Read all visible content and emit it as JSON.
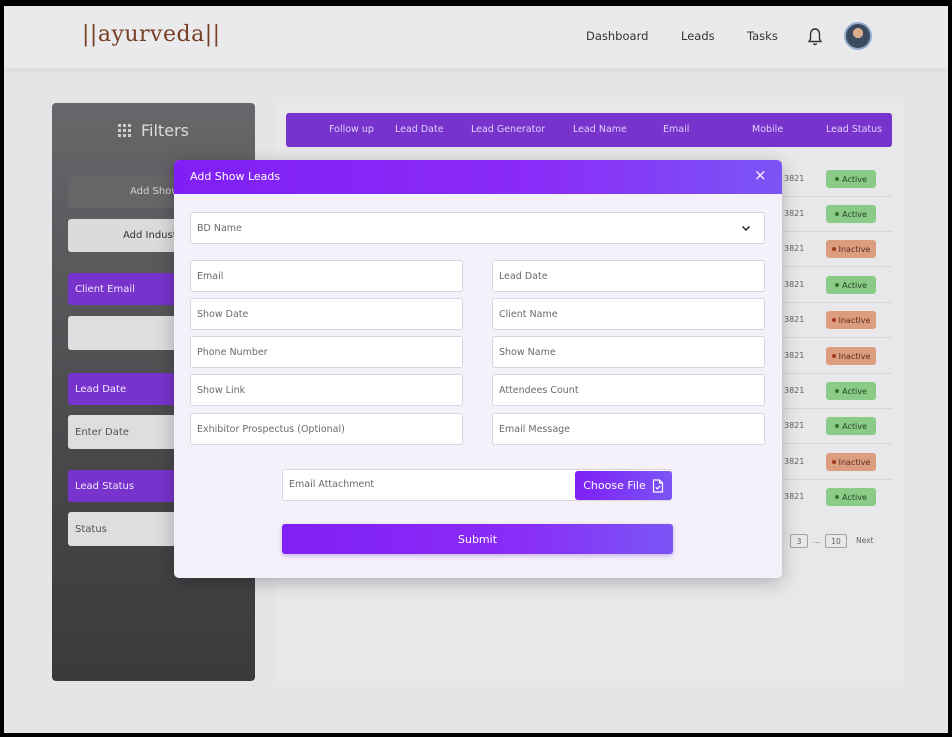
{
  "brand": {
    "logo_text": "||ayurveda||"
  },
  "nav": {
    "items": [
      "Dashboard",
      "Leads",
      "Tasks"
    ]
  },
  "sidebar": {
    "title": "Filters",
    "add_show_button": "Add Show",
    "add_industry_button": "Add Indust",
    "client_email_label": "Client Email",
    "client_email_value": "",
    "lead_date_label": "Lead Date",
    "lead_date_placeholder": "Enter Date",
    "lead_status_label": "Lead Status",
    "lead_status_placeholder": "Status"
  },
  "table": {
    "columns": [
      "Follow up",
      "Lead Date",
      "Lead Generator",
      "Lead Name",
      "Email",
      "Mobile",
      "Lead Status"
    ],
    "rows": [
      {
        "mobile": "3821",
        "status": "Active"
      },
      {
        "mobile": "3821",
        "status": "Active"
      },
      {
        "mobile": "3821",
        "status": "Inactive"
      },
      {
        "mobile": "3821",
        "status": "Active"
      },
      {
        "mobile": "3821",
        "status": "Inactive"
      },
      {
        "mobile": "3821",
        "status": "Inactive"
      },
      {
        "mobile": "3821",
        "status": "Active"
      },
      {
        "mobile": "3821",
        "status": "Active"
      },
      {
        "mobile": "3821",
        "status": "Inactive"
      },
      {
        "mobile": "3821",
        "status": "Active"
      }
    ],
    "pagination": {
      "page_3": "3",
      "ellipsis": "...",
      "last_page": "10",
      "next": "Next"
    }
  },
  "modal": {
    "title": "Add Show Leads",
    "close_glyph": "×",
    "bd_name_placeholder": "BD Name",
    "fields_left": [
      "Email",
      "Show Date",
      "Phone Number",
      "Show Link",
      "Exhibitor Prospectus (Optional)"
    ],
    "fields_right": [
      "Lead Date",
      "Client Name",
      "Show Name",
      "Attendees Count",
      "Email Message"
    ],
    "attachment_placeholder": "Email Attachment",
    "choose_file_label": "Choose File",
    "submit_label": "Submit"
  },
  "colors": {
    "accent": "#6d22c8",
    "active": "#7fc77d",
    "inactive": "#d99575"
  }
}
